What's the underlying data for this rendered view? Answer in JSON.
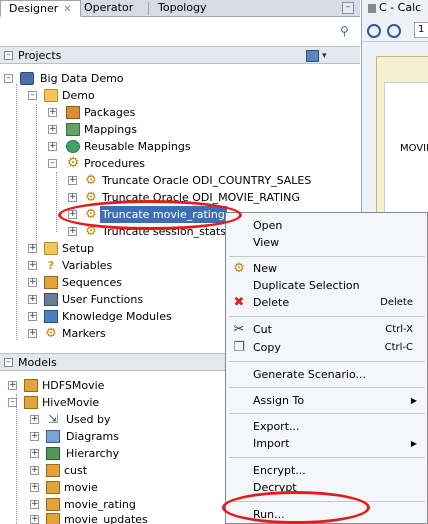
{
  "tabs": [
    {
      "label": "Designer",
      "active": true
    },
    {
      "label": "Operator",
      "active": false
    },
    {
      "label": "Topology",
      "active": false
    }
  ],
  "right_panel": {
    "tab_label": "C - Calc",
    "zoom_value": "1",
    "canvas_text": "MOVIE"
  },
  "projects": {
    "header": "Projects",
    "tree": {
      "root": "Big Data Demo",
      "folder": "Demo",
      "folder_items": [
        "Packages",
        "Mappings",
        "Reusable Mappings",
        "Procedures"
      ],
      "procedures": [
        "Truncate Oracle ODI_COUNTRY_SALES",
        "Truncate Oracle ODI_MOVIE_RATING",
        "Truncate movie_rating",
        "Truncate session_stats"
      ],
      "selected_procedure": "Truncate movie_rating",
      "root_items": [
        "Setup",
        "Variables",
        "Sequences",
        "User Functions",
        "Knowledge Modules",
        "Markers"
      ]
    }
  },
  "models": {
    "header": "Models",
    "items": [
      "HDFSMovie",
      "HiveMovie"
    ],
    "hive_children": [
      "Used by",
      "Diagrams",
      "Hierarchy",
      "cust",
      "movie",
      "movie_rating",
      "movie_updates"
    ]
  },
  "context_menu": {
    "items": [
      {
        "label": "Open",
        "shortcut": ""
      },
      {
        "label": "View",
        "shortcut": ""
      },
      {
        "label": "New",
        "shortcut": ""
      },
      {
        "label": "Duplicate Selection",
        "shortcut": ""
      },
      {
        "label": "Delete",
        "shortcut": "Delete"
      },
      {
        "label": "Cut",
        "shortcut": "Ctrl-X"
      },
      {
        "label": "Copy",
        "shortcut": "Ctrl-C"
      },
      {
        "label": "Generate Scenario...",
        "shortcut": ""
      },
      {
        "label": "Assign To",
        "shortcut": ""
      },
      {
        "label": "Export...",
        "shortcut": ""
      },
      {
        "label": "Import",
        "shortcut": ""
      },
      {
        "label": "Encrypt...",
        "shortcut": ""
      },
      {
        "label": "Decrypt",
        "shortcut": ""
      },
      {
        "label": "Run...",
        "shortcut": ""
      }
    ]
  },
  "colors": {
    "selection": "#3e6db5",
    "annotation": "#e21c1c"
  }
}
